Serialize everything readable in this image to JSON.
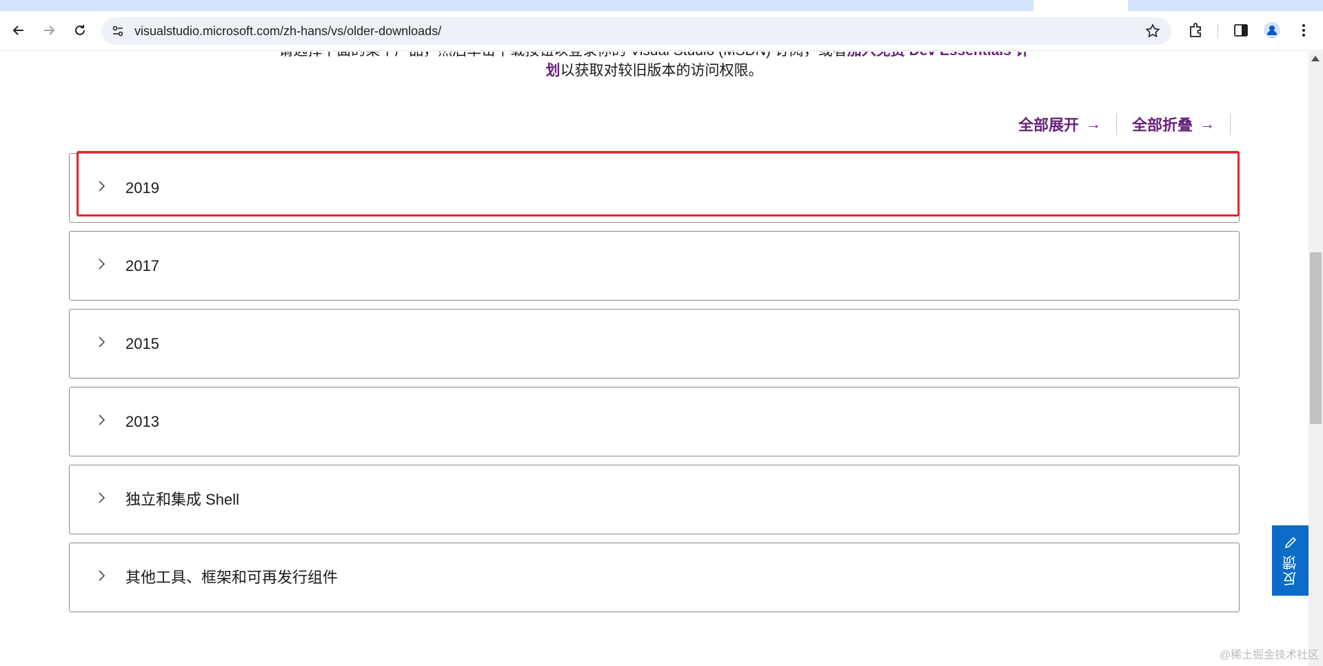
{
  "browser": {
    "url": "visualstudio.microsoft.com/zh-hans/vs/older-downloads/"
  },
  "intro": {
    "line1_text": "请选择下面的某个产品，然后单击下载按钮以登录你的 Visual Studio (MSDN) 订阅，或者",
    "line1_link": "加入免费 Dev Essentials 计",
    "line2_link": "划",
    "line2_text": "以获取对较旧版本的访问权限。"
  },
  "controls": {
    "expand_all": "全部展开",
    "collapse_all": "全部折叠",
    "arrow": "→"
  },
  "accordion": {
    "items": [
      {
        "label": "2019"
      },
      {
        "label": "2017"
      },
      {
        "label": "2015"
      },
      {
        "label": "2013"
      },
      {
        "label": "独立和集成 Shell"
      },
      {
        "label": "其他工具、框架和可再发行组件"
      }
    ]
  },
  "feedback": {
    "label": "反馈"
  },
  "watermark": {
    "text": "@稀土掘金技术社区"
  },
  "colors": {
    "link": "#68217a",
    "highlight": "#e0262a",
    "feedback_bg": "#0a6bc8"
  }
}
